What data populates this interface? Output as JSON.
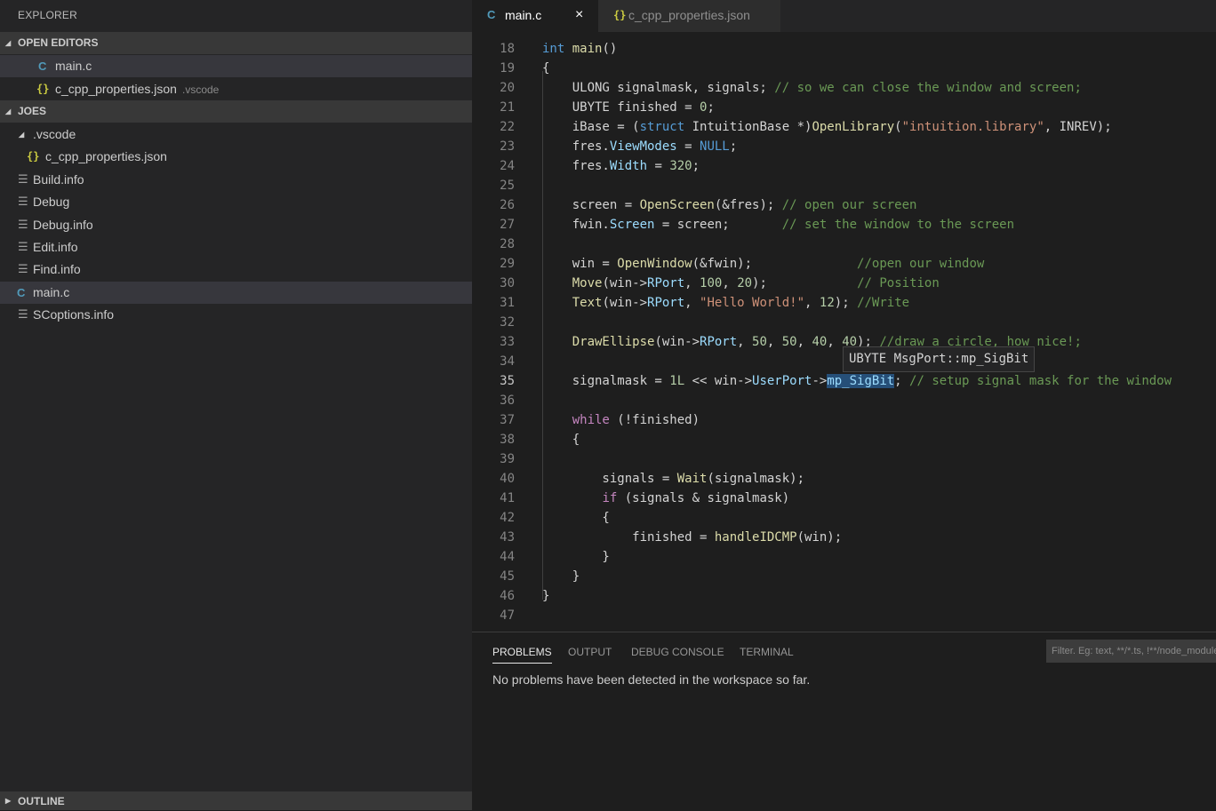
{
  "sidebar": {
    "title": "EXPLORER",
    "open_editors": {
      "header": "OPEN EDITORS",
      "items": [
        {
          "icon": "C",
          "label": "main.c",
          "hint": ""
        },
        {
          "icon": "{}",
          "label": "c_cpp_properties.json",
          "hint": ".vscode"
        }
      ]
    },
    "workspace": {
      "header": "JOES",
      "folder": ".vscode",
      "items": [
        {
          "icon": "{}",
          "label": "c_cpp_properties.json"
        },
        {
          "icon": "file",
          "label": "Build.info"
        },
        {
          "icon": "file",
          "label": "Debug"
        },
        {
          "icon": "file",
          "label": "Debug.info"
        },
        {
          "icon": "file",
          "label": "Edit.info"
        },
        {
          "icon": "file",
          "label": "Find.info"
        },
        {
          "icon": "C",
          "label": "main.c"
        },
        {
          "icon": "file",
          "label": "SCoptions.info"
        }
      ]
    },
    "outline": "OUTLINE"
  },
  "tabs": [
    {
      "icon": "C",
      "label": "main.c",
      "active": true,
      "close": "×"
    },
    {
      "icon": "{}",
      "label": "c_cpp_properties.json",
      "active": false
    }
  ],
  "editor": {
    "active_line": 35,
    "hover": "UBYTE MsgPort::mp_SigBit",
    "lines": [
      {
        "n": "18",
        "tokens": [
          [
            "kw",
            "int"
          ],
          [
            "p",
            " "
          ],
          [
            "fn",
            "main"
          ],
          [
            "p",
            "()"
          ]
        ]
      },
      {
        "n": "19",
        "tokens": [
          [
            "p",
            "{"
          ]
        ]
      },
      {
        "n": "20",
        "tokens": [
          [
            "p",
            "    ULONG signalmask, signals; "
          ],
          [
            "cmt",
            "// so we can close the window and screen;"
          ]
        ]
      },
      {
        "n": "21",
        "tokens": [
          [
            "p",
            "    UBYTE finished = "
          ],
          [
            "num",
            "0"
          ],
          [
            "p",
            ";"
          ]
        ]
      },
      {
        "n": "22",
        "tokens": [
          [
            "p",
            "    iBase = ("
          ],
          [
            "kw",
            "struct"
          ],
          [
            "p",
            " IntuitionBase *)"
          ],
          [
            "fn",
            "OpenLibrary"
          ],
          [
            "p",
            "("
          ],
          [
            "str",
            "\"intuition.library\""
          ],
          [
            "p",
            ", INREV);"
          ]
        ]
      },
      {
        "n": "23",
        "tokens": [
          [
            "p",
            "    fres."
          ],
          [
            "prop",
            "ViewModes"
          ],
          [
            "p",
            " = "
          ],
          [
            "kw",
            "NULL"
          ],
          [
            "p",
            ";"
          ]
        ]
      },
      {
        "n": "24",
        "tokens": [
          [
            "p",
            "    fres."
          ],
          [
            "prop",
            "Width"
          ],
          [
            "p",
            " = "
          ],
          [
            "num",
            "320"
          ],
          [
            "p",
            ";"
          ]
        ]
      },
      {
        "n": "25",
        "tokens": []
      },
      {
        "n": "26",
        "tokens": [
          [
            "p",
            "    screen = "
          ],
          [
            "fn",
            "OpenScreen"
          ],
          [
            "p",
            "(&fres); "
          ],
          [
            "cmt",
            "// open our screen"
          ]
        ]
      },
      {
        "n": "27",
        "tokens": [
          [
            "p",
            "    fwin."
          ],
          [
            "prop",
            "Screen"
          ],
          [
            "p",
            " = screen;       "
          ],
          [
            "cmt",
            "// set the window to the screen"
          ]
        ]
      },
      {
        "n": "28",
        "tokens": []
      },
      {
        "n": "29",
        "tokens": [
          [
            "p",
            "    win = "
          ],
          [
            "fn",
            "OpenWindow"
          ],
          [
            "p",
            "(&fwin);              "
          ],
          [
            "cmt",
            "//open our window"
          ]
        ]
      },
      {
        "n": "30",
        "tokens": [
          [
            "p",
            "    "
          ],
          [
            "fn",
            "Move"
          ],
          [
            "p",
            "(win->"
          ],
          [
            "prop",
            "RPort"
          ],
          [
            "p",
            ", "
          ],
          [
            "num",
            "100"
          ],
          [
            "p",
            ", "
          ],
          [
            "num",
            "20"
          ],
          [
            "p",
            ");            "
          ],
          [
            "cmt",
            "// Position"
          ]
        ]
      },
      {
        "n": "31",
        "tokens": [
          [
            "p",
            "    "
          ],
          [
            "fn",
            "Text"
          ],
          [
            "p",
            "(win->"
          ],
          [
            "prop",
            "RPort"
          ],
          [
            "p",
            ", "
          ],
          [
            "str",
            "\"Hello World!\""
          ],
          [
            "p",
            ", "
          ],
          [
            "num",
            "12"
          ],
          [
            "p",
            "); "
          ],
          [
            "cmt",
            "//Write"
          ]
        ]
      },
      {
        "n": "32",
        "tokens": []
      },
      {
        "n": "33",
        "tokens": [
          [
            "p",
            "    "
          ],
          [
            "fn",
            "DrawEllipse"
          ],
          [
            "p",
            "(win->"
          ],
          [
            "prop",
            "RPort"
          ],
          [
            "p",
            ", "
          ],
          [
            "num",
            "50"
          ],
          [
            "p",
            ", "
          ],
          [
            "num",
            "50"
          ],
          [
            "p",
            ", "
          ],
          [
            "num",
            "40"
          ],
          [
            "p",
            ", "
          ],
          [
            "num",
            "40"
          ],
          [
            "p",
            "); "
          ],
          [
            "cmt",
            "//draw a circle, how nice!;"
          ]
        ]
      },
      {
        "n": "34",
        "tokens": []
      },
      {
        "n": "35",
        "tokens": [
          [
            "p",
            "    signalmask = "
          ],
          [
            "num",
            "1L"
          ],
          [
            "p",
            " << win->"
          ],
          [
            "prop",
            "UserPort"
          ],
          [
            "p",
            "->"
          ],
          [
            "hl",
            "mp_SigBit"
          ],
          [
            "p",
            "; "
          ],
          [
            "cmt",
            "// setup signal mask for the window"
          ]
        ]
      },
      {
        "n": "36",
        "tokens": []
      },
      {
        "n": "37",
        "tokens": [
          [
            "p",
            "    "
          ],
          [
            "ctl",
            "while"
          ],
          [
            "p",
            " (!finished)"
          ]
        ]
      },
      {
        "n": "38",
        "tokens": [
          [
            "p",
            "    {"
          ]
        ]
      },
      {
        "n": "39",
        "tokens": []
      },
      {
        "n": "40",
        "tokens": [
          [
            "p",
            "        signals = "
          ],
          [
            "fn",
            "Wait"
          ],
          [
            "p",
            "(signalmask);"
          ]
        ]
      },
      {
        "n": "41",
        "tokens": [
          [
            "p",
            "        "
          ],
          [
            "ctl",
            "if"
          ],
          [
            "p",
            " (signals & signalmask)"
          ]
        ]
      },
      {
        "n": "42",
        "tokens": [
          [
            "p",
            "        {"
          ]
        ]
      },
      {
        "n": "43",
        "tokens": [
          [
            "p",
            "            finished = "
          ],
          [
            "fn",
            "handleIDCMP"
          ],
          [
            "p",
            "(win);"
          ]
        ]
      },
      {
        "n": "44",
        "tokens": [
          [
            "p",
            "        }"
          ]
        ]
      },
      {
        "n": "45",
        "tokens": [
          [
            "p",
            "    }"
          ]
        ]
      },
      {
        "n": "46",
        "tokens": [
          [
            "p",
            "}"
          ]
        ]
      },
      {
        "n": "47",
        "tokens": []
      }
    ]
  },
  "panel": {
    "tabs": [
      "PROBLEMS",
      "OUTPUT",
      "DEBUG CONSOLE",
      "TERMINAL"
    ],
    "active_tab": "PROBLEMS",
    "filter_placeholder": "Filter. Eg: text, **/*.ts, !**/node_modules/**",
    "message": "No problems have been detected in the workspace so far."
  },
  "colors": {
    "sidebar_bg": "#252526",
    "editor_bg": "#1e1e1e",
    "selection": "#37373d",
    "keyword": "#569cd6",
    "function": "#dcdcaa",
    "string": "#ce9178",
    "comment": "#6a9955"
  }
}
